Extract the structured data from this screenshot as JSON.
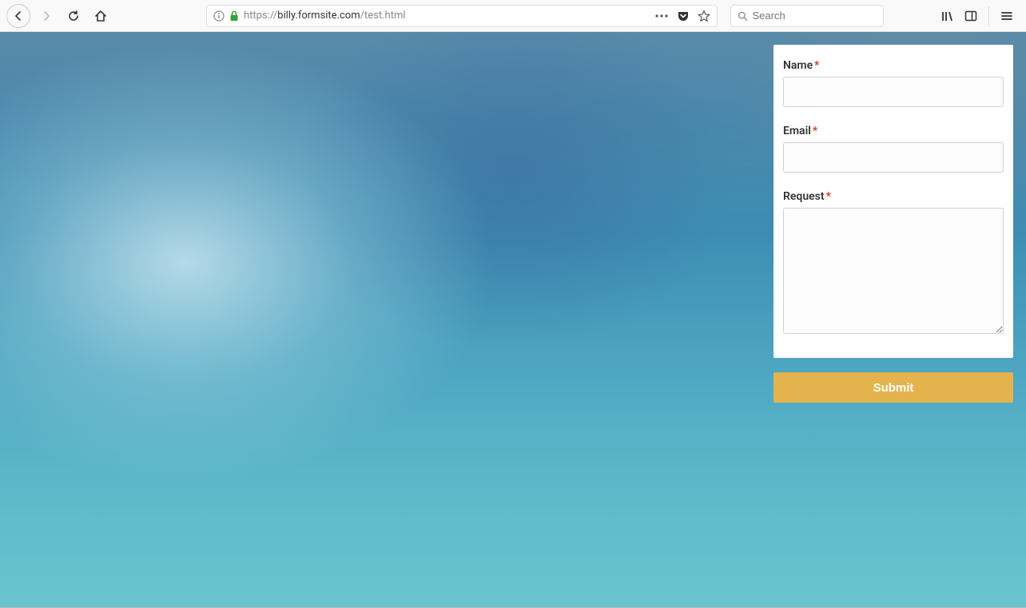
{
  "browser": {
    "url_prefix": "https://",
    "url_domain": "billy.formsite.com",
    "url_path": "/test.html",
    "search_placeholder": "Search"
  },
  "form": {
    "fields": {
      "name": {
        "label": "Name",
        "required": "*",
        "value": ""
      },
      "email": {
        "label": "Email",
        "required": "*",
        "value": ""
      },
      "request": {
        "label": "Request",
        "required": "*",
        "value": ""
      }
    },
    "submit_label": "Submit"
  },
  "colors": {
    "accent": "#e5b34d",
    "required": "#d93025"
  }
}
